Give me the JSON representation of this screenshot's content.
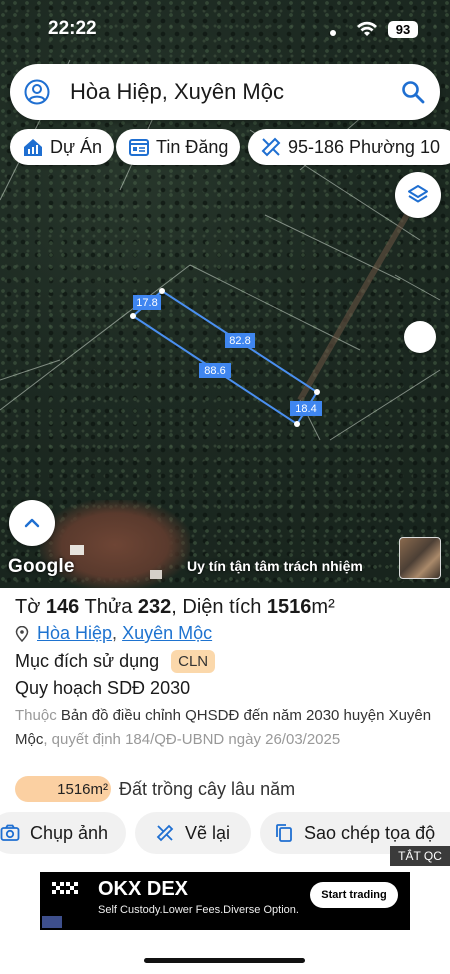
{
  "status_bar": {
    "time": "22:22",
    "battery": "93"
  },
  "search": {
    "text": "Hòa Hiệp, Xuyên Mộc"
  },
  "chips": [
    {
      "label": "Dự Án",
      "icon": "house-chart-icon"
    },
    {
      "label": "Tin Đăng",
      "icon": "listing-icon"
    },
    {
      "label": "95-186 Phường 10",
      "icon": "ruler-pencil-icon"
    }
  ],
  "map": {
    "measurements": [
      "17.8",
      "82.8",
      "88.6",
      "18.4"
    ],
    "google_label": "Google",
    "slogan": "Uy tín tận tâm trách nhiệm"
  },
  "parcel": {
    "to_label": "Tờ",
    "to_value": "146",
    "thua_label": "Thửa",
    "thua_value": "232",
    "area_label": "Diện tích",
    "area_value": "1516",
    "area_unit": "m²",
    "location_ward": "Hòa Hiệp",
    "location_district": "Xuyên Mộc",
    "purpose_label": "Mục đích sử dụng",
    "purpose_code": "CLN",
    "plan_title": "Quy hoạch SDĐ 2030",
    "plan_prefix": "Thuộc",
    "plan_doc": "Bản đồ điều chỉnh QHSDĐ đến năm 2030 huyện Xuyên Mộc",
    "plan_decision": ", quyết định 184/QĐ-UBND ngày 26/03/2025",
    "area_chip": "1516m²",
    "area_desc": "Đất trồng cây lâu năm"
  },
  "actions": {
    "photo": "Chụp ảnh",
    "redraw": "Vẽ lại",
    "copy": "Sao chép tọa độ"
  },
  "ad": {
    "hide_label": "TẮT QC",
    "headline": "OKX DEX",
    "sub": "Self Custody.Lower Fees.Diverse Option.",
    "cta": "Start trading"
  }
}
